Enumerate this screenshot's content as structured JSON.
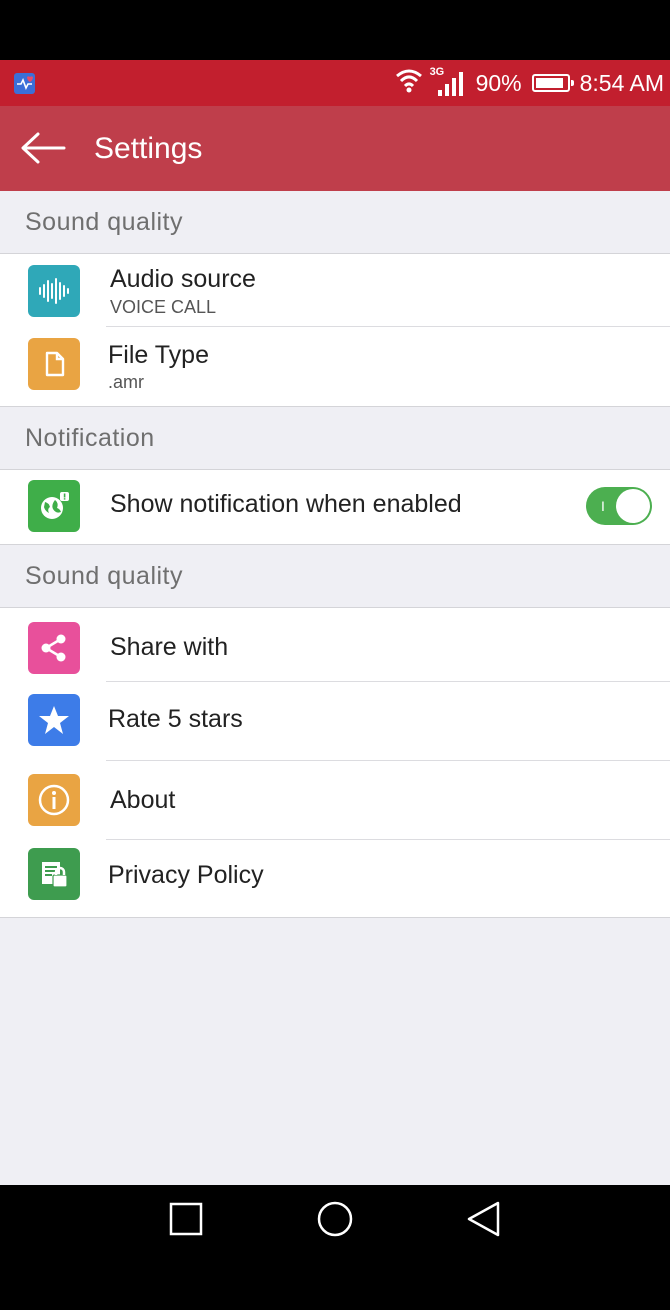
{
  "status_bar": {
    "network": "3G",
    "battery": "90%",
    "battery_level": 0.9,
    "time": "8:54 AM",
    "color": "#c21f2e"
  },
  "app_bar": {
    "title": "Settings",
    "color": "#bf3e4b"
  },
  "sections": [
    {
      "header": "Sound quality",
      "items": [
        {
          "title": "Audio source",
          "subtitle": "VOICE CALL",
          "icon": "audio-wave-icon",
          "icon_color": "#2fa8b8"
        },
        {
          "title": "File Type",
          "subtitle": ".amr",
          "icon": "file-icon",
          "icon_color": "#e9a443"
        }
      ]
    },
    {
      "header": "Notification",
      "items": [
        {
          "title": "Show notification when enabled",
          "icon": "notification-globe-icon",
          "icon_color": "#3fae49",
          "toggle_on": true,
          "toggle_mark": "I"
        }
      ]
    },
    {
      "header": "Sound quality",
      "items": [
        {
          "title": "Share with",
          "icon": "share-icon",
          "icon_color": "#e8509b"
        },
        {
          "title": "Rate 5 stars",
          "icon": "star-icon",
          "icon_color": "#3d7ce8"
        },
        {
          "title": "About",
          "icon": "info-icon",
          "icon_color": "#e9a443"
        },
        {
          "title": "Privacy Policy",
          "icon": "privacy-lock-icon",
          "icon_color": "#3e9c4f"
        }
      ]
    }
  ],
  "nav_bar": {
    "buttons": [
      "recents-icon",
      "home-icon",
      "back-triangle-icon"
    ]
  }
}
